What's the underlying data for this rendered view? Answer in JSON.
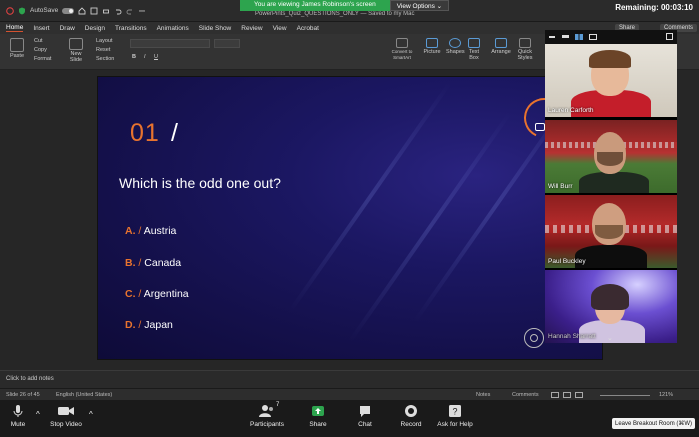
{
  "titlebar": {
    "autosave_label": "AutoSave",
    "toggle_state": "ON",
    "doc_title": "PowerPints_Quiz_QUESTIONS_ONLY — Saved to my Mac",
    "remaining": "Remaining: 00:03:10"
  },
  "share_banner": {
    "viewing_text": "You are viewing James Robinson's screen",
    "view_options": "View Options"
  },
  "ribbon": {
    "tabs": [
      "Home",
      "Insert",
      "Draw",
      "Design",
      "Transitions",
      "Animations",
      "Slide Show",
      "Review",
      "View",
      "Acrobat"
    ],
    "share_label": "Share",
    "comments_label": "Comments",
    "paste": "Paste",
    "cut": "Cut",
    "copy": "Copy",
    "format": "Format",
    "new_slide": "New Slide",
    "layout": "Layout",
    "reset": "Reset",
    "section": "Section",
    "convert_smartart": "Convert to SmartArt",
    "picture": "Picture",
    "shapes": "Shapes",
    "text_box": "Text Box",
    "arrange": "Arrange",
    "quick_styles": "Quick Styles"
  },
  "slide": {
    "number": "01",
    "slash": "/",
    "question": "Which is the odd one out?",
    "answers": [
      {
        "letter": "A.",
        "sep": "/",
        "text": "Austria"
      },
      {
        "letter": "B.",
        "sep": "/",
        "text": "Canada"
      },
      {
        "letter": "C.",
        "sep": "/",
        "text": "Argentina"
      },
      {
        "letter": "D.",
        "sep": "/",
        "text": "Japan"
      }
    ]
  },
  "notes": {
    "placeholder": "Click to add notes"
  },
  "status": {
    "slide_count": "Slide 26 of 45",
    "language": "English (United States)",
    "notes_label": "Notes",
    "comments_label": "Comments",
    "zoom": "121%"
  },
  "participants_panel": [
    {
      "name": "Lauren Carforth"
    },
    {
      "name": "Will Burr"
    },
    {
      "name": "Paul Buckley"
    },
    {
      "name": "Hannah Sharratt"
    }
  ],
  "zoom_toolbar": {
    "mute": "Mute",
    "stop_video": "Stop Video",
    "participants": "Participants",
    "participants_count": "7",
    "share": "Share",
    "chat": "Chat",
    "record": "Record",
    "ask_for_help": "Ask for Help",
    "leave": "Leave Breakout Room (⌘W)"
  },
  "colors": {
    "accent_orange": "#e8732e",
    "slide_bg": "#1b1762",
    "zoom_green": "#2da44e",
    "share_green": "#2da44e"
  }
}
